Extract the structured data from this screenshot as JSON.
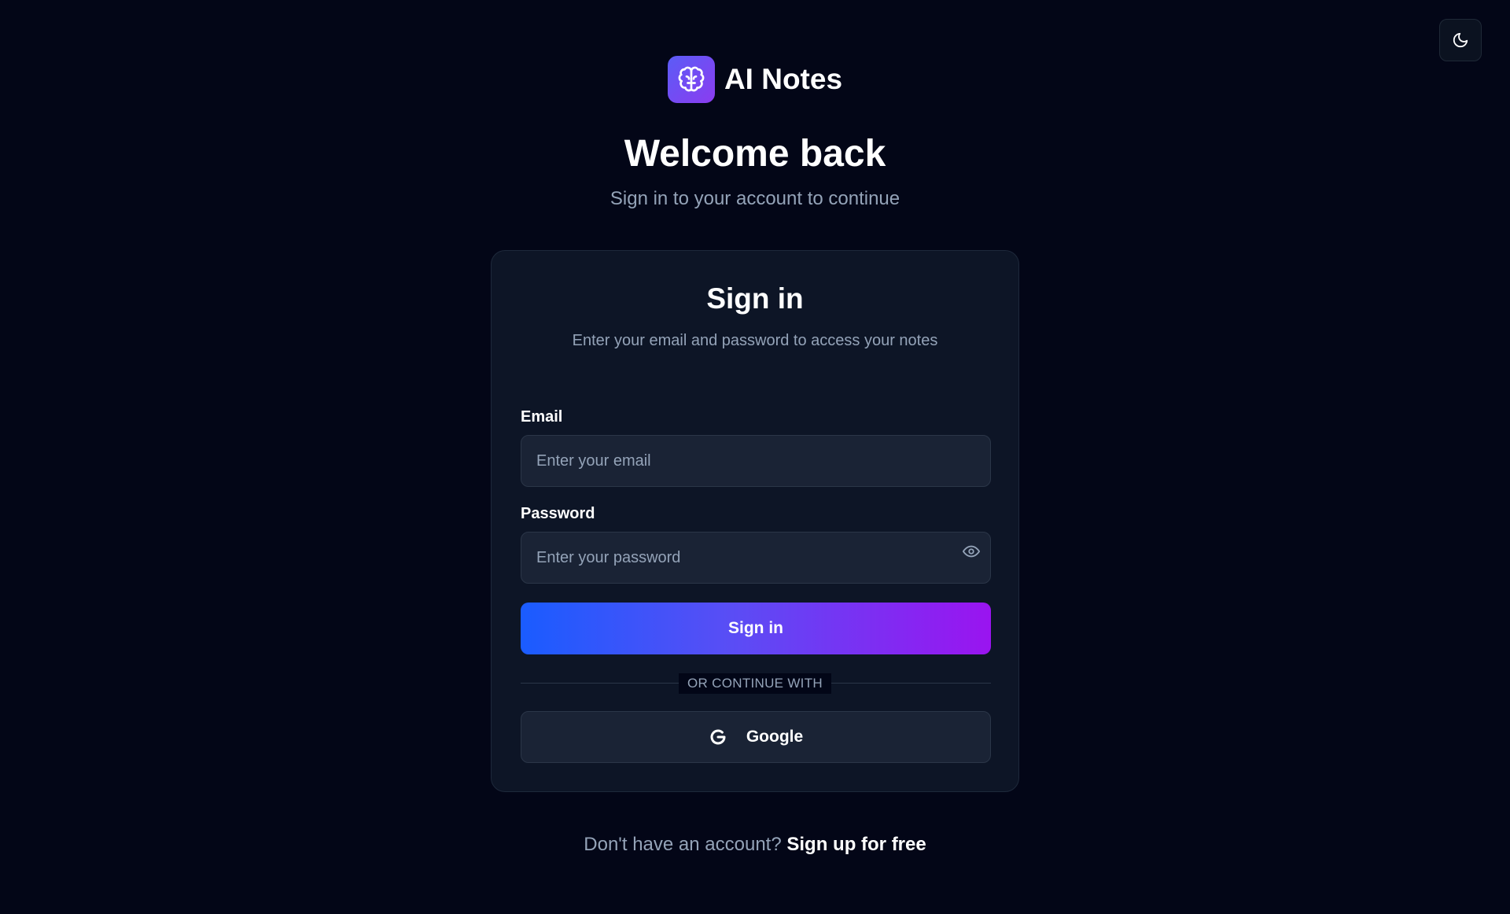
{
  "brand": {
    "name": "AI Notes",
    "logo_icon": "brain-icon",
    "logo_gradient": [
      "#5b5cf6",
      "#8b3cf0"
    ]
  },
  "theme_toggle": {
    "icon": "moon-icon"
  },
  "header": {
    "title": "Welcome back",
    "subtitle": "Sign in to your account to continue"
  },
  "card": {
    "title": "Sign in",
    "description": "Enter your email and password to access your notes",
    "email": {
      "label": "Email",
      "placeholder": "Enter your email",
      "value": ""
    },
    "password": {
      "label": "Password",
      "placeholder": "Enter your password",
      "value": "",
      "toggle_icon": "eye-icon"
    },
    "submit_label": "Sign in",
    "divider_label": "OR CONTINUE WITH",
    "google": {
      "label": "Google",
      "icon": "google-icon"
    }
  },
  "footer": {
    "prompt": "Don't have an account?",
    "link_label": "Sign up for free"
  },
  "colors": {
    "background": "#030617",
    "card": "#0d1526",
    "input": "#1a2335",
    "muted_text": "#94a3b8",
    "button_gradient": [
      "#1a5cff",
      "#9a14f0"
    ]
  }
}
